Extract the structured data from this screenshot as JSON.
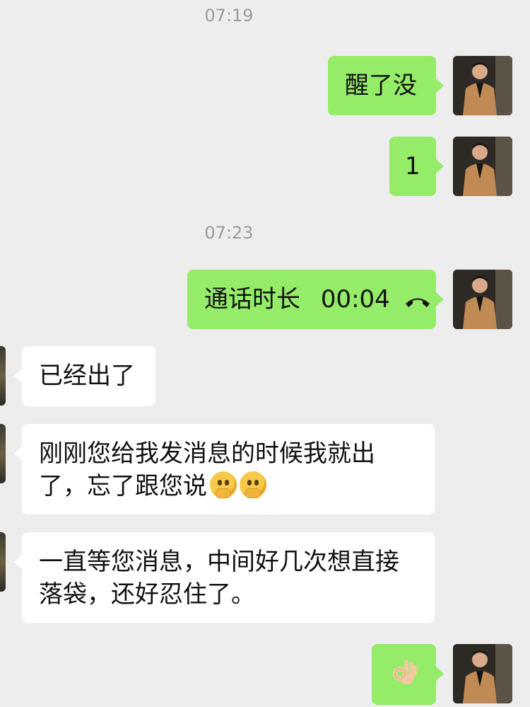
{
  "chat": {
    "timestamps": [
      "07:19",
      "07:23"
    ],
    "messages": [
      {
        "sender": "me",
        "text": "醒了没"
      },
      {
        "sender": "me",
        "text": "1"
      },
      {
        "sender": "me",
        "type": "call",
        "label": "通话时长",
        "duration": "00:04",
        "icon": "hangup-phone-icon"
      },
      {
        "sender": "them",
        "text": "已经出了"
      },
      {
        "sender": "them",
        "line1": "刚刚您给我发消息的时候我就出",
        "line2": "了，忘了跟您说",
        "emoji": "thinking-face-icon"
      },
      {
        "sender": "them",
        "line1": "一直等您消息，中间好几次想直接",
        "line2": "落袋，还好忍住了。"
      },
      {
        "sender": "me",
        "type": "emoji",
        "icon": "ok-hand-icon"
      }
    ]
  }
}
